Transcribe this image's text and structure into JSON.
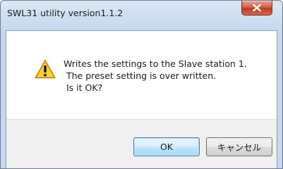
{
  "window": {
    "title": "SWL31 utility version1.1.2",
    "close_icon": "close-x-icon"
  },
  "dialog": {
    "icon": "warning-triangle-icon",
    "message": "Writes the settings to the Slave station 1.\n The preset setting is over written.\n Is it OK?"
  },
  "buttons": {
    "ok_label": "OK",
    "cancel_label": "キャンセル"
  },
  "colors": {
    "close_button": "#c7432a",
    "warning_icon": "#f6c21a",
    "ok_border": "#3c7fb1"
  }
}
